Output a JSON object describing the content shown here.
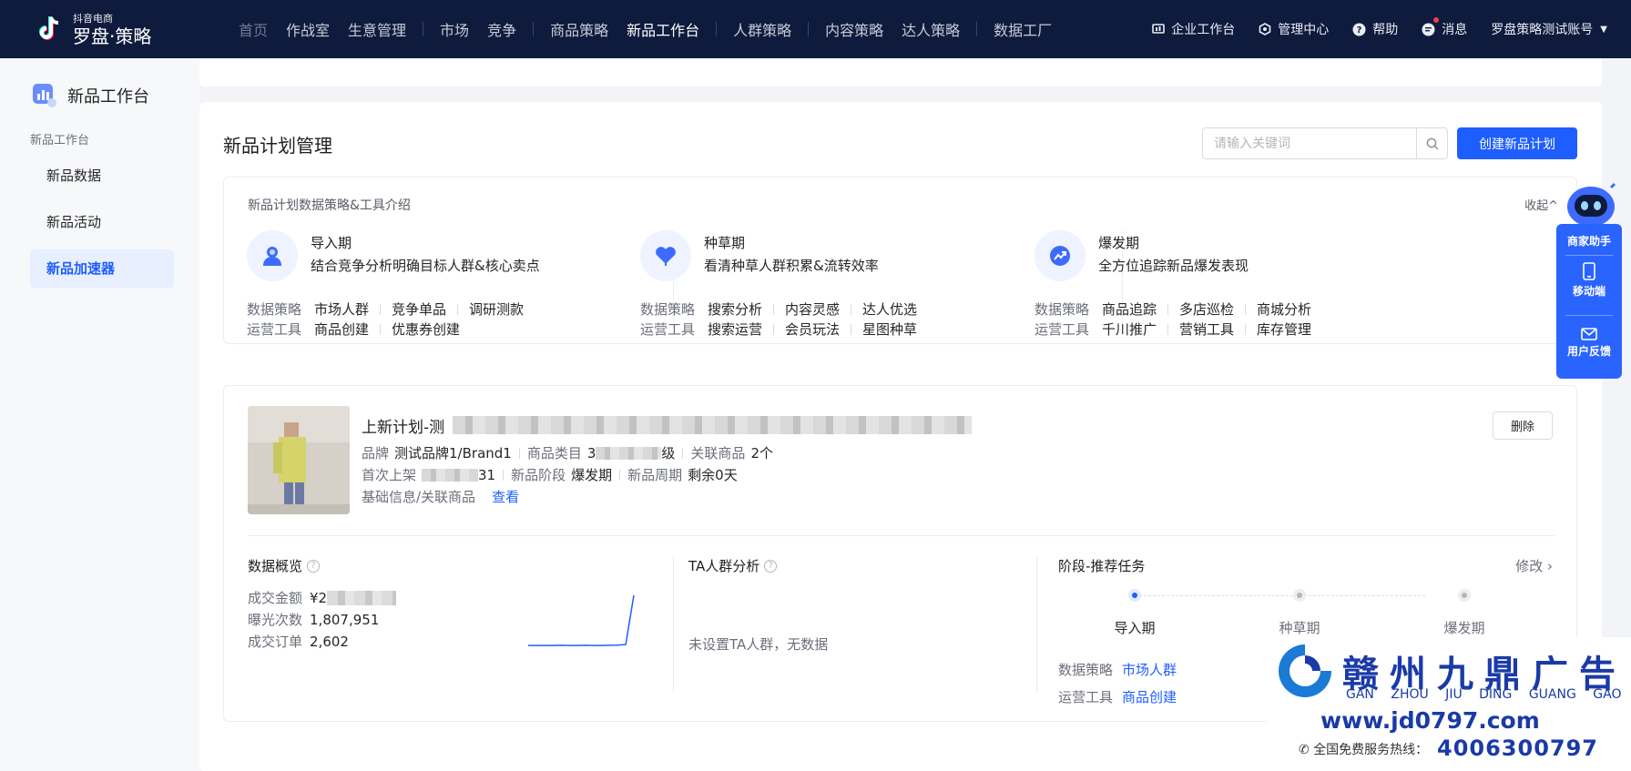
{
  "brand": {
    "sub": "抖音电商",
    "name": "罗盘·策略"
  },
  "nav": {
    "groups": [
      [
        "首页",
        "作战室",
        "生意管理"
      ],
      [
        "市场",
        "竞争"
      ],
      [
        "商品策略",
        "新品工作台"
      ],
      [
        "人群策略"
      ],
      [
        "内容策略",
        "达人策略"
      ],
      [
        "数据工厂"
      ]
    ],
    "active": "新品工作台",
    "muted": "首页"
  },
  "top_right": {
    "workspace": "企业工作台",
    "admin": "管理中心",
    "help": "帮助",
    "messages": "消息",
    "account": "罗盘策略测试账号"
  },
  "sidebar": {
    "title": "新品工作台",
    "group": "新品工作台",
    "items": [
      {
        "label": "新品数据"
      },
      {
        "label": "新品活动"
      },
      {
        "label": "新品加速器"
      }
    ]
  },
  "main": {
    "title": "新品计划管理",
    "search": {
      "placeholder": "请输入关键词",
      "value": ""
    },
    "create_label": "创建新品计划"
  },
  "intro": {
    "title": "新品计划数据策略&工具介绍",
    "collapse": "收起^",
    "data_label": "数据策略",
    "tool_label": "运营工具",
    "phases": [
      {
        "name": "导入期",
        "desc": "结合竞争分析明确目标人群&核心卖点",
        "data": [
          "市场人群",
          "竞争单品",
          "调研测款"
        ],
        "tools": [
          "商品创建",
          "优惠券创建"
        ]
      },
      {
        "name": "种草期",
        "desc": "看清种草人群积累&流转效率",
        "data": [
          "搜索分析",
          "内容灵感",
          "达人优选"
        ],
        "tools": [
          "搜索运营",
          "会员玩法",
          "星图种草"
        ]
      },
      {
        "name": "爆发期",
        "desc": "全方位追踪新品爆发表现",
        "data": [
          "商品追踪",
          "多店巡检",
          "商城分析"
        ],
        "tools": [
          "千川推广",
          "营销工具",
          "库存管理"
        ]
      }
    ]
  },
  "plan": {
    "name": "上新计划-测",
    "brand_label": "品牌",
    "brand": "测试品牌1/Brand1",
    "category_label": "商品类目",
    "category": "3",
    "category_tail": "级",
    "related_label": "关联商品",
    "related": "2个",
    "first_launch_label": "首次上架",
    "first_launch_tail": "31",
    "stage_label": "新品阶段",
    "stage": "爆发期",
    "cycle_label": "新品周期",
    "cycle": "剩余0天",
    "info_label": "基础信息/关联商品",
    "view": "查看",
    "delete": "删除",
    "overview": {
      "title": "数据概览",
      "gmv_label": "成交金额",
      "gmv": "¥2",
      "exposure_label": "曝光次数",
      "exposure": "1,807,951",
      "orders_label": "成交订单",
      "orders": "2,602"
    },
    "ta": {
      "title": "TA人群分析",
      "empty": "未设置TA人群，无数据"
    },
    "tasks": {
      "title": "阶段-推荐任务",
      "edit": "修改",
      "steps": [
        "导入期",
        "种草期",
        "爆发期"
      ],
      "current_step": 0,
      "data_label": "数据策略",
      "data_link": "市场人群",
      "tool_label": "运营工具",
      "tool_link": "商品创建"
    }
  },
  "float": {
    "assistant": "商家助手",
    "mobile": "移动端",
    "feedback": "用户反馈"
  },
  "ad": {
    "title": "赣州九鼎广告",
    "pinyin": "GAN ZHOU JIU DING GUANG GAO",
    "url": "www.jd0797.com",
    "hotline_label": "全国免费服务热线：",
    "hotline": "4006300797"
  },
  "colors": {
    "accent": "#1e5eff",
    "nav_bg": "#0f1b3d",
    "float": "#2a64ff"
  },
  "chart_data": {
    "type": "line",
    "x": [
      1,
      2,
      3,
      4,
      5,
      6,
      7,
      8,
      9,
      10,
      11,
      12,
      13,
      14
    ],
    "values": [
      0.5,
      0.5,
      0.5,
      0.5,
      0.6,
      0.5,
      0.5,
      0.6,
      0.5,
      0.5,
      0.6,
      0.7,
      1,
      30
    ],
    "ylim": [
      0,
      30
    ],
    "color": "#1e5eff"
  }
}
